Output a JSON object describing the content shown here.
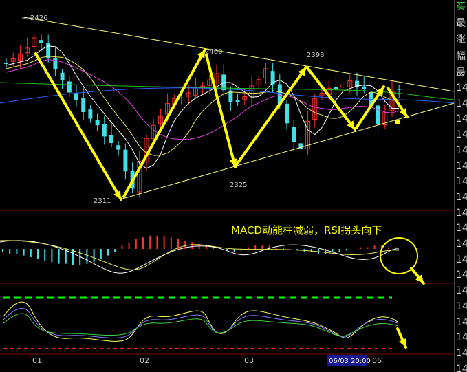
{
  "right_panel": {
    "header": "买",
    "labels": [
      "最",
      "涨",
      "幅",
      "最"
    ],
    "prices": [
      "14",
      "14",
      "14",
      "14",
      "14",
      "14",
      "14",
      "14",
      "14",
      "14",
      "14",
      "14",
      "14",
      "14",
      "14",
      "14",
      "14",
      "14",
      "14"
    ]
  },
  "annotation": "MACD动能柱减弱，RSI拐头向下",
  "highlight_time": "06/03 20:00",
  "colors": {
    "up": "#ff3030",
    "down": "#40e0e8",
    "arrow": "#ffff00",
    "trendline": "#ffff80",
    "rsi_top_level": "#00ff00",
    "rsi_bottom_level": "#ff2020",
    "ma_yellow": "#e8e860",
    "ma_pink": "#e040e0",
    "ma_green": "#20c020",
    "ma_blue": "#3060ff"
  },
  "chart_data": {
    "type": "candlestick",
    "price_labels": [
      "2426",
      "2400",
      "2398",
      "2325",
      "2311"
    ],
    "x_ticks": [
      "01",
      "02",
      "03",
      "06"
    ],
    "macd_hist": [
      -2,
      -3,
      -3,
      -4,
      -5,
      -6,
      -7,
      -8,
      -9,
      -9,
      -10,
      -10,
      -9,
      -8,
      -6,
      -4,
      -2,
      2,
      4,
      6,
      7,
      8,
      8,
      8,
      7,
      6,
      5,
      4,
      3,
      2,
      1,
      0,
      -1,
      -2,
      -1,
      1,
      2,
      2,
      2,
      1,
      1,
      0,
      -1,
      -2,
      -2,
      -3,
      -3,
      -2,
      -2,
      -1,
      0,
      1,
      1,
      2,
      2,
      1,
      1
    ],
    "rsi_levels": {
      "top": "dashed green",
      "bottom": "dashed red"
    }
  }
}
